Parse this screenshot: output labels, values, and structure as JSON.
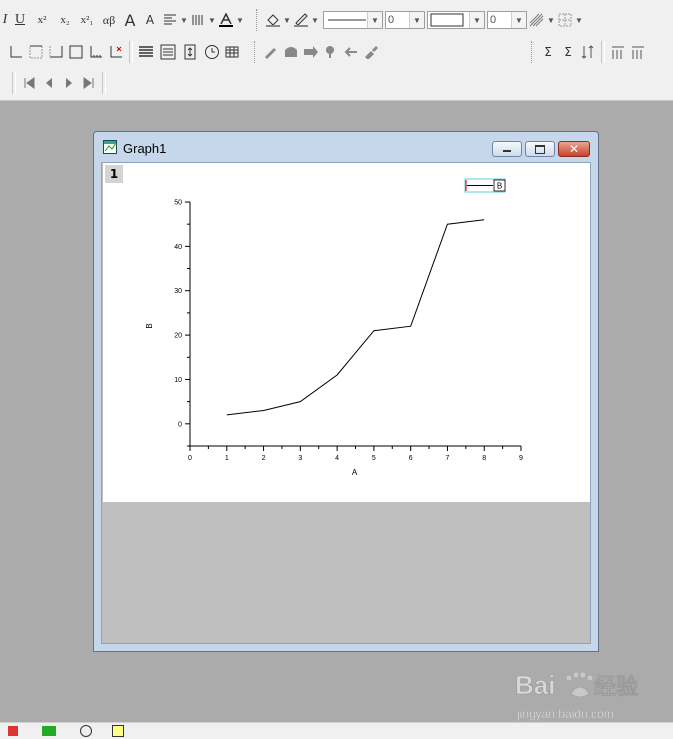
{
  "toolbar": {
    "format": {
      "italic_label": "I",
      "underline_label": "U",
      "superscript_label": "x²",
      "subscript_label": "x₂",
      "supsub_label": "x²₁",
      "greek_label": "αβ",
      "increase_font_label": "A",
      "decrease_font_label": "A"
    },
    "line_width_value": "0",
    "border_width_value": "0"
  },
  "window": {
    "title": "Graph1",
    "layer_number": "1"
  },
  "chart_data": {
    "type": "line",
    "xlabel": "A",
    "ylabel": "B",
    "xlim": [
      0,
      9
    ],
    "ylim": [
      -5,
      50
    ],
    "x_ticks": [
      "0",
      "1",
      "2",
      "3",
      "4",
      "5",
      "6",
      "7",
      "8",
      "9"
    ],
    "y_ticks": [
      "0",
      "10",
      "20",
      "30",
      "40",
      "50"
    ],
    "series": [
      {
        "name": "B",
        "x": [
          1,
          2,
          3,
          4,
          5,
          6,
          7,
          8
        ],
        "values": [
          2,
          3,
          5,
          11,
          21,
          22,
          45,
          46
        ]
      }
    ],
    "legend_position": "top-right",
    "grid": false
  },
  "watermark": {
    "text": "Bai du 经验",
    "url": "jingyan.baidu.com"
  }
}
